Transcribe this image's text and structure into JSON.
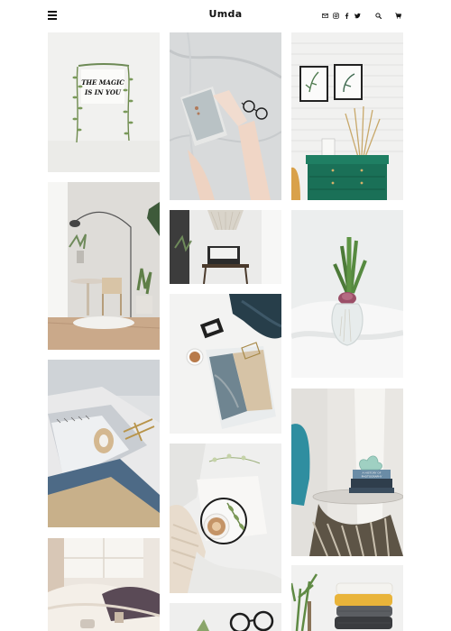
{
  "header": {
    "brand": "Umda",
    "icons": [
      "menu-icon",
      "mail-icon",
      "instagram-icon",
      "facebook-icon",
      "twitter-icon",
      "search-icon",
      "cart-icon"
    ]
  },
  "sign_text": [
    "THE MAGIC",
    "IS IN YOU"
  ],
  "book_title": [
    "A HISTORY OF",
    "PHOTOGRAPHY"
  ],
  "colors": {
    "text": "#111111",
    "cabinet_green": "#1f7f63",
    "background": "#ffffff"
  }
}
